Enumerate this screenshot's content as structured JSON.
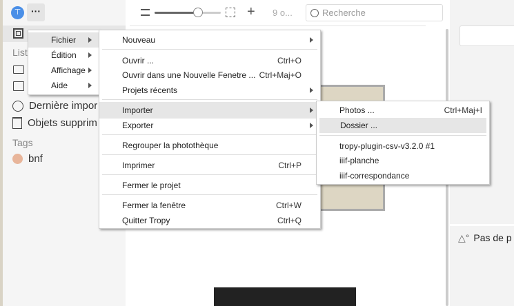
{
  "sidebar": {
    "lists_label": "List",
    "last_import": "Dernière impor",
    "deleted": "Objets supprim",
    "tags_label": "Tags",
    "tags": [
      {
        "name": "bnf",
        "color": "#e8b59a"
      }
    ]
  },
  "toolbar": {
    "count": "9 o...",
    "search_placeholder": "Recherche",
    "zoom_value": 0.65
  },
  "right_panel": {
    "no_photo": "Pas de p"
  },
  "menu_main": [
    {
      "label": "Fichier",
      "highlighted": true
    },
    {
      "label": "Édition"
    },
    {
      "label": "Affichage"
    },
    {
      "label": "Aide"
    }
  ],
  "menu_file": [
    {
      "label": "Nouveau",
      "submenu": true
    },
    {
      "label": "Ouvrir ...",
      "shortcut": "Ctrl+O"
    },
    {
      "label": "Ouvrir dans une Nouvelle Fenetre ...",
      "shortcut": "Ctrl+Maj+O"
    },
    {
      "label": "Projets récents",
      "submenu": true
    },
    {
      "label": "Importer",
      "submenu": true,
      "highlighted": true
    },
    {
      "label": "Exporter",
      "submenu": true
    },
    {
      "label": "Regrouper la photothèque"
    },
    {
      "label": "Imprimer",
      "shortcut": "Ctrl+P"
    },
    {
      "label": "Fermer le projet"
    },
    {
      "label": "Fermer la fenêtre",
      "shortcut": "Ctrl+W"
    },
    {
      "label": "Quitter Tropy",
      "shortcut": "Ctrl+Q"
    }
  ],
  "menu_import": [
    {
      "label": "Photos ...",
      "shortcut": "Ctrl+Maj+I"
    },
    {
      "label": "Dossier ...",
      "highlighted": true
    },
    {
      "label": "tropy-plugin-csv-v3.2.0 #1"
    },
    {
      "label": "iiif-planche"
    },
    {
      "label": "iiif-correspondance"
    }
  ],
  "colors": {
    "accent": "#4a8fe7",
    "highlight": "#e6e6e6"
  }
}
